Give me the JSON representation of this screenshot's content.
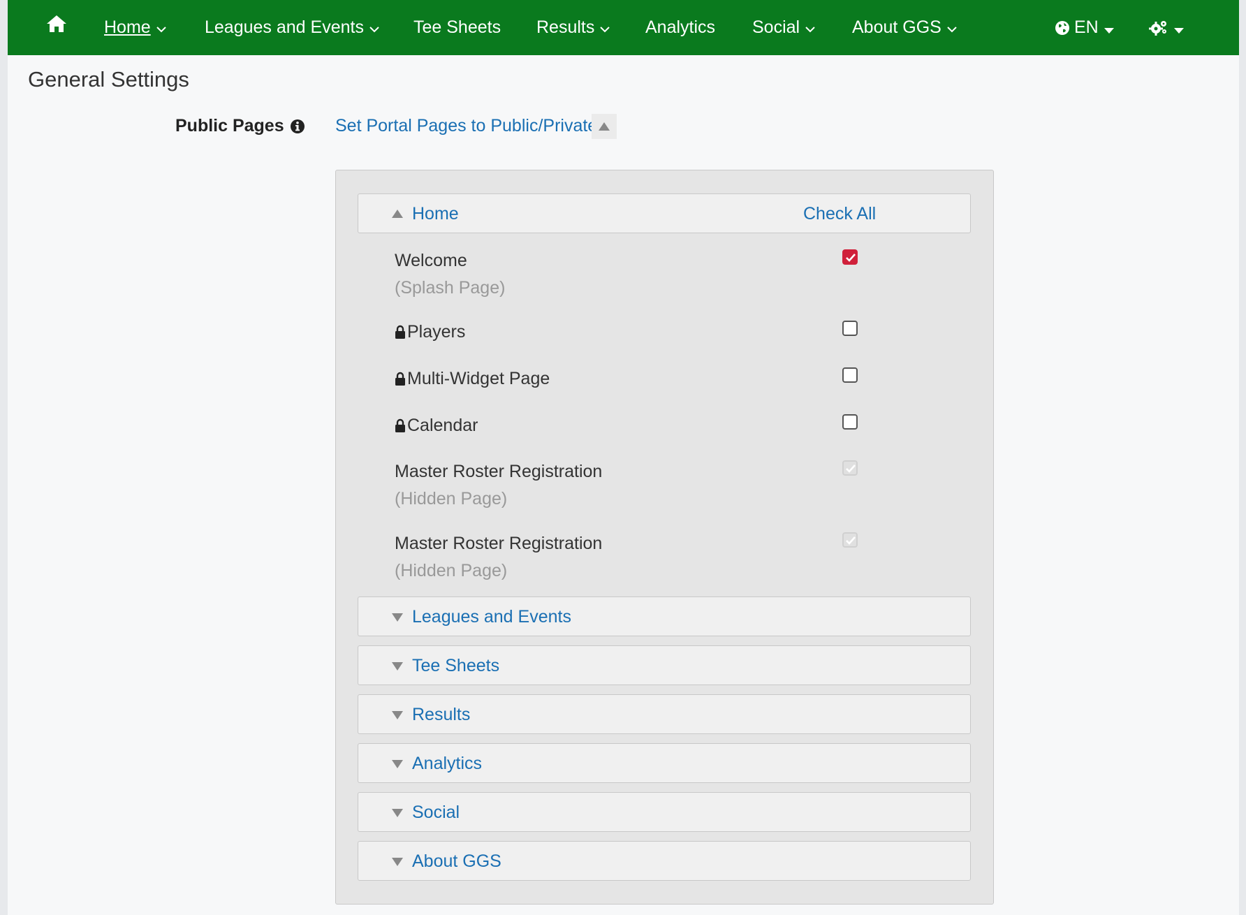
{
  "nav": {
    "items": [
      {
        "label": "Home",
        "has_chevron": true,
        "active": true
      },
      {
        "label": "Leagues and Events",
        "has_chevron": true
      },
      {
        "label": "Tee Sheets",
        "has_chevron": false
      },
      {
        "label": "Results",
        "has_chevron": true
      },
      {
        "label": "Analytics",
        "has_chevron": false
      },
      {
        "label": "Social",
        "has_chevron": true
      },
      {
        "label": "About GGS",
        "has_chevron": true
      }
    ],
    "language": "EN",
    "home_icon": "home-icon",
    "globe_icon": "globe-icon",
    "settings_icon": "gears-icon",
    "bg_color": "#0a7a1e"
  },
  "page": {
    "title": "General Settings",
    "public_pages_label": "Public Pages",
    "portal_link": "Set Portal Pages to Public/Private"
  },
  "panel": {
    "open_section": {
      "title": "Home",
      "check_all": "Check All",
      "rows": [
        {
          "name": "Welcome",
          "sub": "(Splash Page)",
          "locked": false,
          "checked": true,
          "disabled": false
        },
        {
          "name": "Players",
          "sub": "",
          "locked": true,
          "checked": false,
          "disabled": false
        },
        {
          "name": "Multi-Widget Page",
          "sub": "",
          "locked": true,
          "checked": false,
          "disabled": false
        },
        {
          "name": "Calendar",
          "sub": "",
          "locked": true,
          "checked": false,
          "disabled": false
        },
        {
          "name": "Master Roster Registration",
          "sub": "(Hidden Page)",
          "locked": false,
          "checked": true,
          "disabled": true
        },
        {
          "name": "Master Roster Registration",
          "sub": "(Hidden Page)",
          "locked": false,
          "checked": true,
          "disabled": true
        }
      ]
    },
    "collapsed_sections": [
      "Leagues and Events",
      "Tee Sheets",
      "Results",
      "Analytics",
      "Social",
      "About GGS"
    ]
  },
  "colors": {
    "link": "#1a6fb3",
    "checked": "#d0203a"
  }
}
